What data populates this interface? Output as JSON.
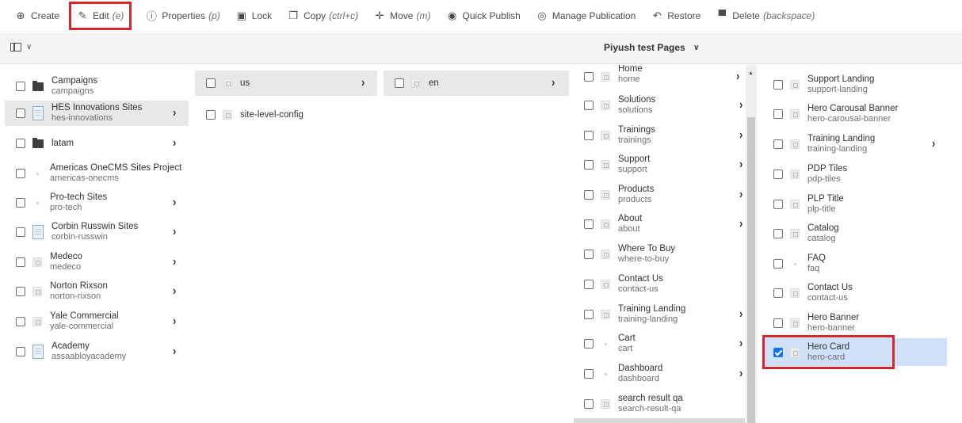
{
  "toolbar": {
    "create": "Create",
    "edit": "Edit",
    "edit_sc": "(e)",
    "properties": "Properties",
    "properties_sc": "(p)",
    "lock": "Lock",
    "copy": "Copy",
    "copy_sc": "(ctrl+c)",
    "move": "Move",
    "move_sc": "(m)",
    "quick_publish": "Quick Publish",
    "manage_publication": "Manage Publication",
    "restore": "Restore",
    "delete": "Delete",
    "delete_sc": "(backspace)"
  },
  "breadcrumb": {
    "title": "Piyush test Pages"
  },
  "column1": [
    {
      "title": "Campaigns",
      "name": "campaigns",
      "thumb": "folder",
      "chevron": false
    },
    {
      "title": "HES Innovations Sites",
      "name": "hes-innovations",
      "thumb": "doc",
      "chevron": true
    },
    {
      "title": "latam",
      "name": "",
      "thumb": "folder",
      "chevron": true
    },
    {
      "title": "Americas OneCMS Sites Project",
      "name": "americas-onecms",
      "thumb": "dot",
      "chevron": true
    },
    {
      "title": "Pro-tech Sites",
      "name": "pro-tech",
      "thumb": "dot",
      "chevron": true
    },
    {
      "title": "Corbin Russwin Sites",
      "name": "corbin-russwin",
      "thumb": "doc",
      "chevron": true
    },
    {
      "title": "Medeco",
      "name": "medeco",
      "thumb": "page",
      "chevron": true
    },
    {
      "title": "Norton Rixson",
      "name": "norton-rixson",
      "thumb": "page",
      "chevron": true
    },
    {
      "title": "Yale Commercial",
      "name": "yale-commercial",
      "thumb": "page",
      "chevron": true
    },
    {
      "title": "Academy",
      "name": "assaabloyacademy",
      "thumb": "doc",
      "chevron": true
    }
  ],
  "column2": [
    {
      "title": "us"
    },
    {
      "title": "site-level-config"
    }
  ],
  "column3": [
    {
      "title": "en"
    }
  ],
  "column4": [
    {
      "title": "Home",
      "name": "home"
    },
    {
      "title": "Solutions",
      "name": "solutions"
    },
    {
      "title": "Trainings",
      "name": "trainings"
    },
    {
      "title": "Support",
      "name": "support"
    },
    {
      "title": "Products",
      "name": "products"
    },
    {
      "title": "About",
      "name": "about"
    },
    {
      "title": "Where To Buy",
      "name": "where-to-buy"
    },
    {
      "title": "Contact Us",
      "name": "contact-us"
    },
    {
      "title": "Training Landing",
      "name": "training-landing"
    },
    {
      "title": "Cart",
      "name": "cart"
    },
    {
      "title": "Dashboard",
      "name": "dashboard"
    },
    {
      "title": "search result qa",
      "name": "search-result-qa"
    }
  ],
  "column5": [
    {
      "title": "Support Landing",
      "name": "support-landing"
    },
    {
      "title": "Hero Carousal Banner",
      "name": "hero-carousal-banner"
    },
    {
      "title": "Training Landing",
      "name": "training-landing"
    },
    {
      "title": "PDP Tiles",
      "name": "pdp-tiles"
    },
    {
      "title": "PLP Title",
      "name": "plp-title"
    },
    {
      "title": "Catalog",
      "name": "catalog"
    },
    {
      "title": "FAQ",
      "name": "faq"
    },
    {
      "title": "Contact Us",
      "name": "contact-us"
    },
    {
      "title": "Hero Banner",
      "name": "hero-banner"
    },
    {
      "title": "Hero Card",
      "name": "hero-card"
    }
  ],
  "colors": {
    "highlight": "#d7262b",
    "selected": "#cfe0f8",
    "checkbox": "#1473e6"
  }
}
